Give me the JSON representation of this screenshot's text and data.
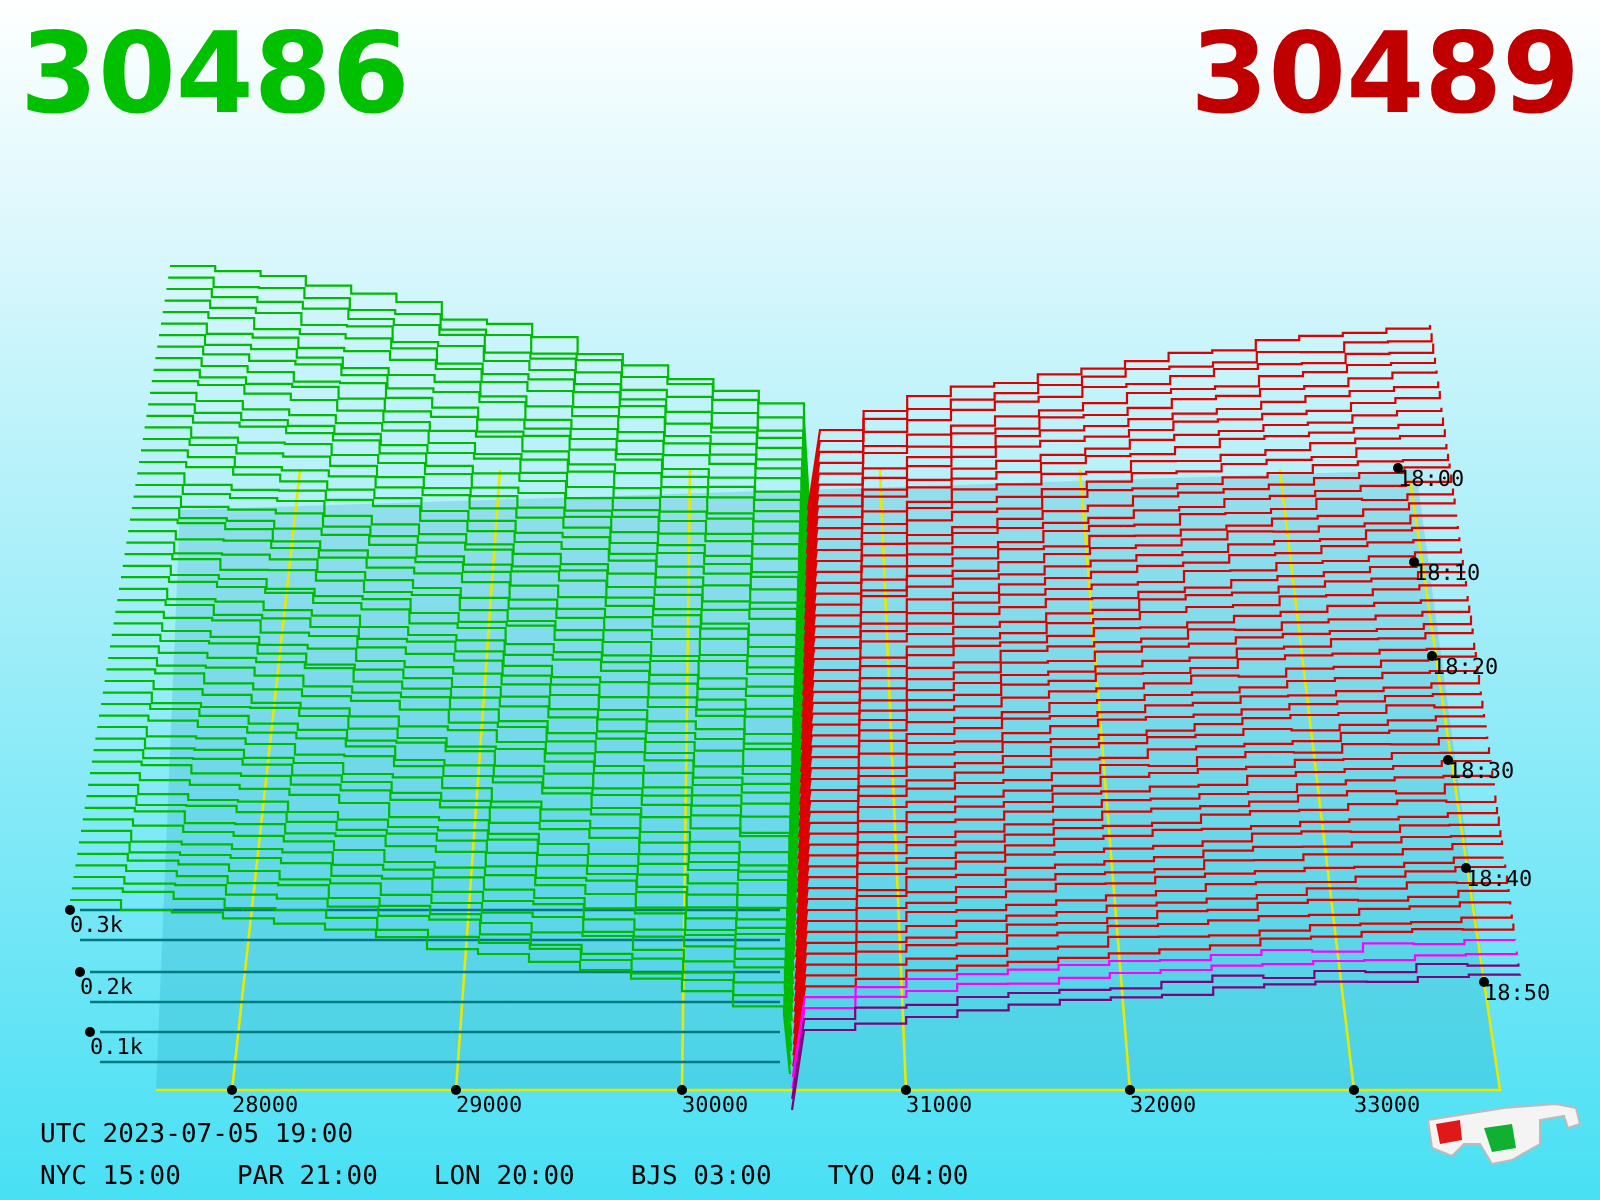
{
  "bid_price": "30486",
  "ask_price": "30489",
  "price_axis": [
    "28000",
    "29000",
    "30000",
    "31000",
    "32000",
    "33000"
  ],
  "volume_axis": [
    "0.3k",
    "0.2k",
    "0.1k"
  ],
  "time_axis": [
    "18:00",
    "18:10",
    "18:20",
    "18:30",
    "18:40",
    "18:50"
  ],
  "utc_time": "UTC 2023-07-05 19:00",
  "city_clocks": [
    {
      "label": "NYC 15:00"
    },
    {
      "label": "PAR 21:00"
    },
    {
      "label": "LON 20:00"
    },
    {
      "label": "BJS 03:00"
    },
    {
      "label": "TYO 04:00"
    }
  ]
}
